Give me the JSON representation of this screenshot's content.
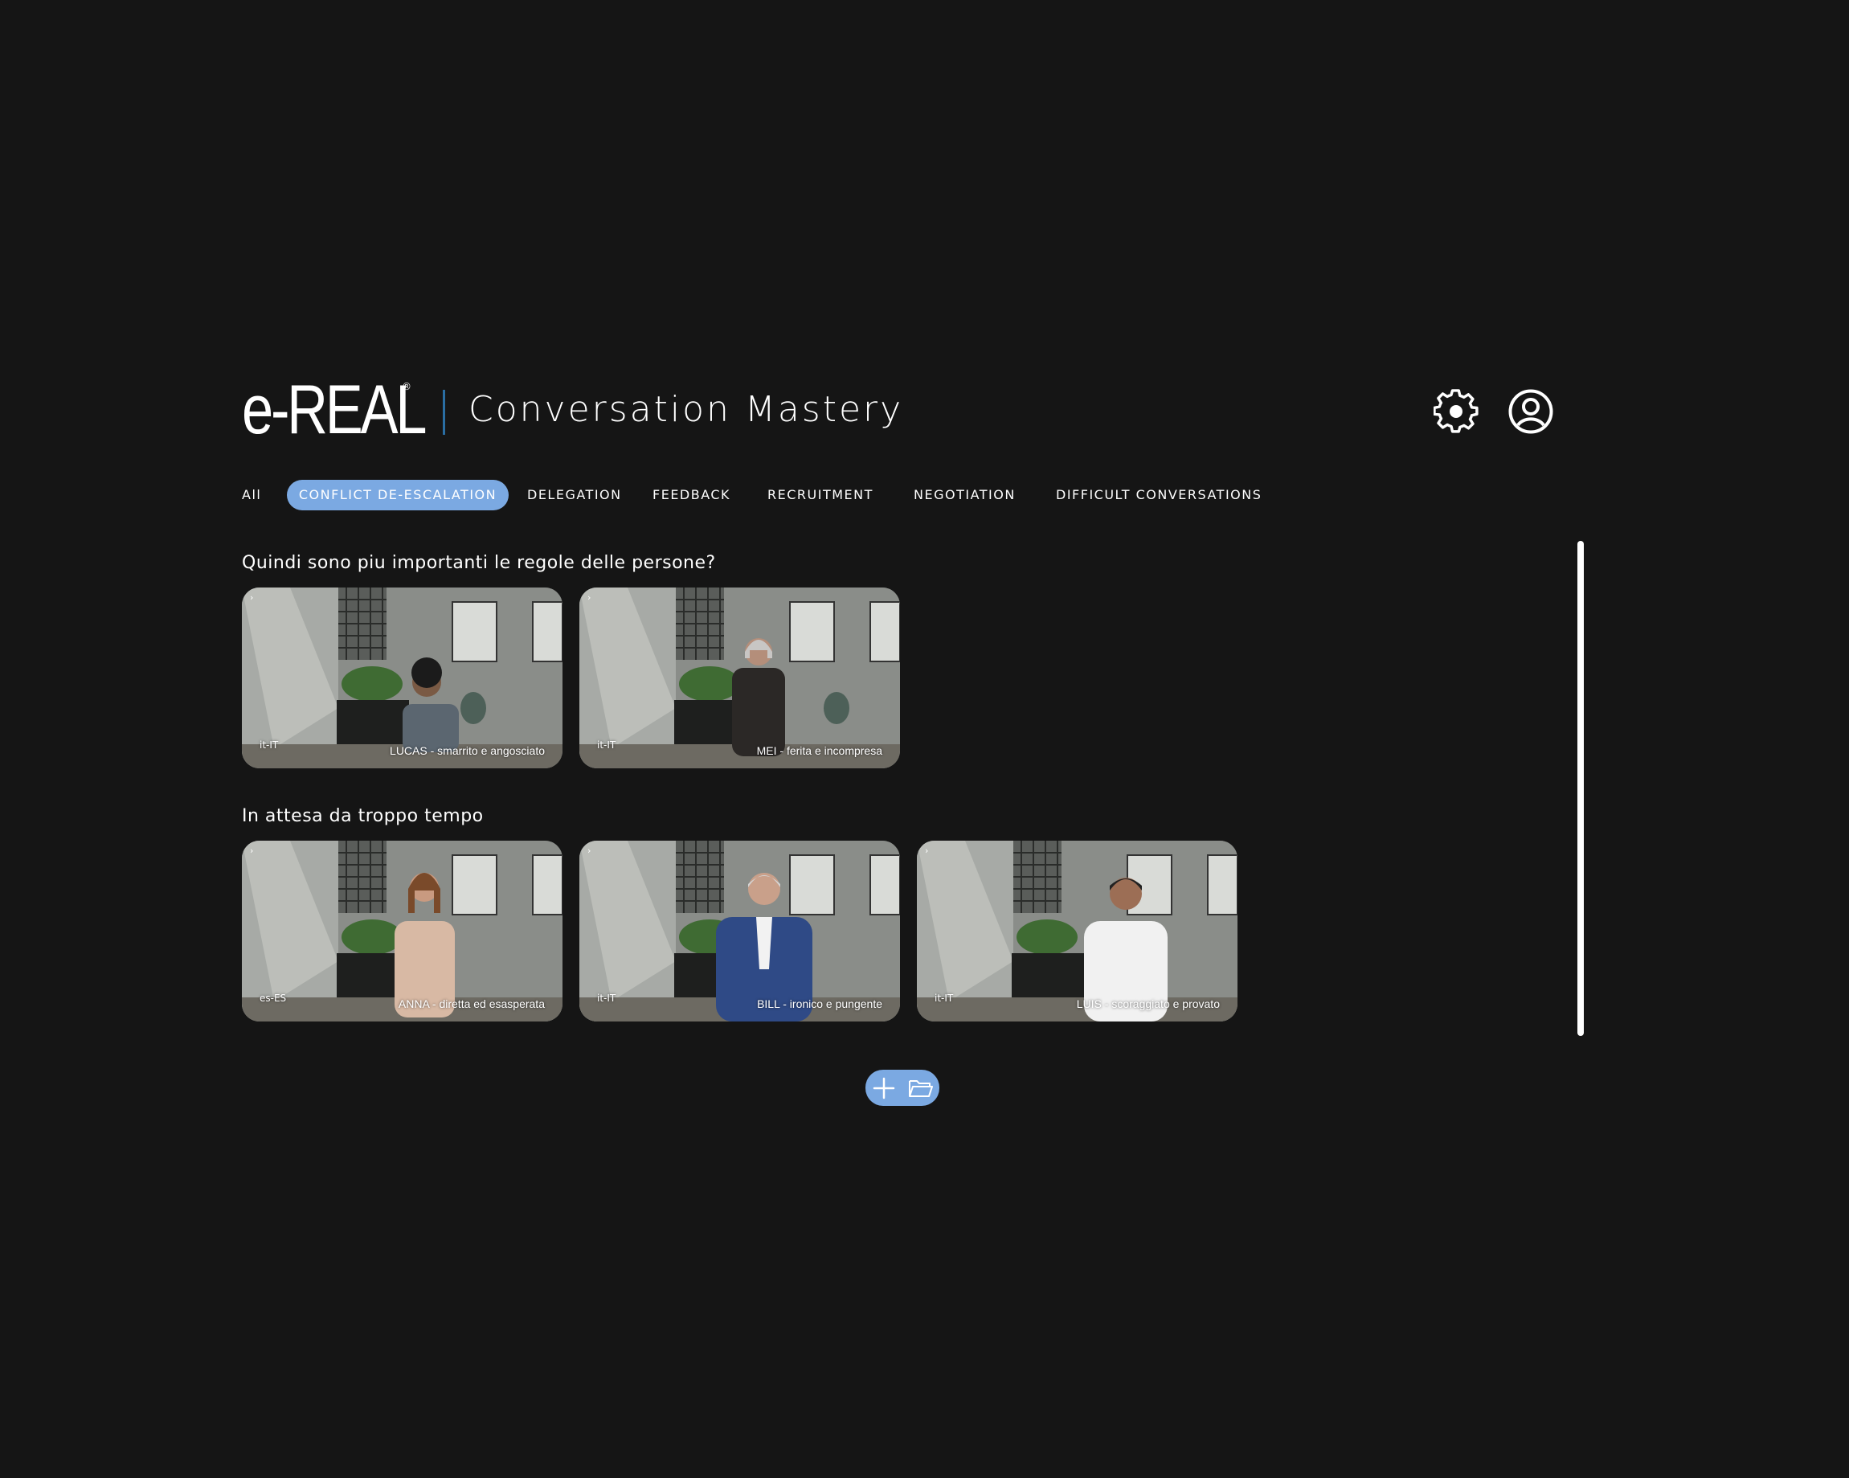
{
  "header": {
    "logo_text": "e-REAL",
    "logo_reg": "®",
    "app_title": "Conversation Mastery",
    "settings_icon": "gear-icon",
    "profile_icon": "user-circle-icon"
  },
  "tabs": [
    {
      "label": "All",
      "active": false
    },
    {
      "label": "CONFLICT DE-ESCALATION",
      "active": true
    },
    {
      "label": "DELEGATION",
      "active": false
    },
    {
      "label": "FEEDBACK",
      "active": false
    },
    {
      "label": "RECRUITMENT",
      "active": false
    },
    {
      "label": "NEGOTIATION",
      "active": false
    },
    {
      "label": "DIFFICULT CONVERSATIONS",
      "active": false
    }
  ],
  "sections": [
    {
      "title": "Quindi sono piu importanti le regole delle persone?",
      "cards": [
        {
          "lang": "it-IT",
          "name": "LUCAS - smarrito e angosciato"
        },
        {
          "lang": "it-IT",
          "name": "MEI - ferita e incompresa"
        }
      ]
    },
    {
      "title": "In attesa da troppo tempo",
      "cards": [
        {
          "lang": "es-ES",
          "name": "ANNA - diretta ed esasperata"
        },
        {
          "lang": "it-IT",
          "name": "BILL - ironico e pungente"
        },
        {
          "lang": "it-IT",
          "name": "LUIS - scoraggiato e provato"
        }
      ]
    }
  ],
  "actions": {
    "add_icon": "plus-icon",
    "folder_icon": "folder-open-icon"
  },
  "colors": {
    "background": "#151515",
    "accent": "#7ba9e2",
    "divider": "#2a6ea3",
    "text": "#ffffff"
  }
}
